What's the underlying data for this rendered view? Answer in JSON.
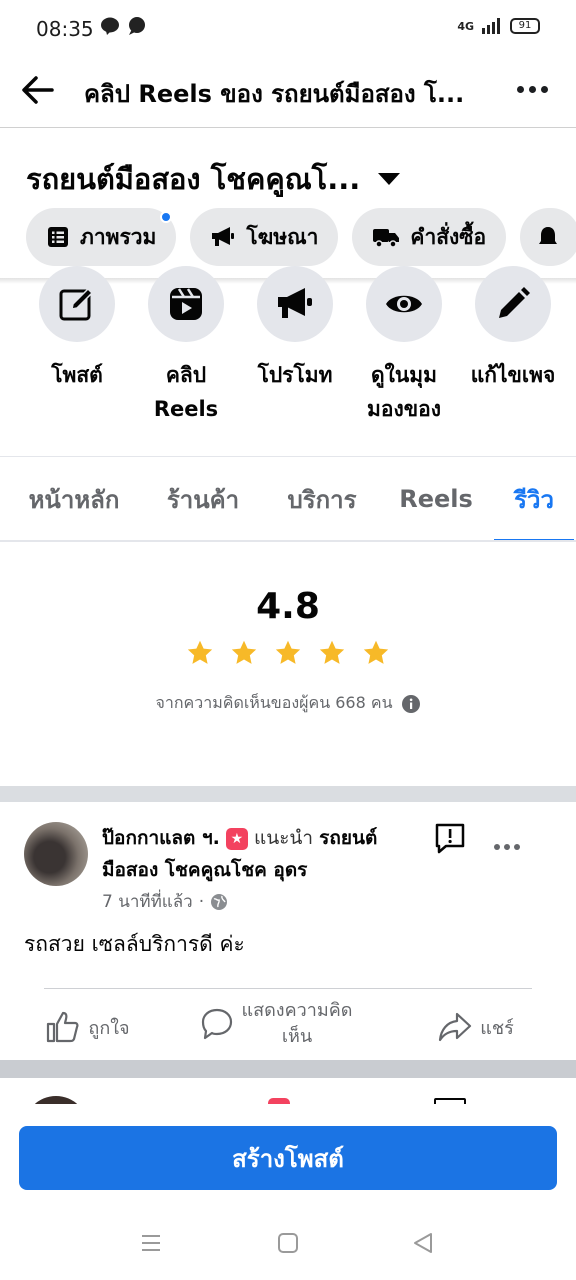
{
  "status_bar": {
    "time": "08:35",
    "network": "4G",
    "battery": "91"
  },
  "header": {
    "title": "คลิป Reels ของ รถยนต์มือสอง โ..."
  },
  "page": {
    "name": "รถยนต์มือสอง โชคคูณโ..."
  },
  "pills": [
    {
      "label": "ภาพรวม",
      "icon": "list-icon"
    },
    {
      "label": "โฆษณา",
      "icon": "megaphone-icon"
    },
    {
      "label": "คำสั่งซื้อ",
      "icon": "truck-icon"
    }
  ],
  "actions": [
    {
      "label": "โพสต์",
      "icon": "edit-square-icon"
    },
    {
      "label": "คลิป Reels",
      "icon": "reels-icon"
    },
    {
      "label": "โปรโมท",
      "icon": "megaphone-icon"
    },
    {
      "label": "ดูในมุมมองของ",
      "icon": "eye-icon"
    },
    {
      "label": "แก้ไขเพจ",
      "icon": "pencil-icon"
    }
  ],
  "tabs": [
    {
      "label": "หน้าหลัก",
      "active": false
    },
    {
      "label": "ร้านค้า",
      "active": false
    },
    {
      "label": "บริการ",
      "active": false
    },
    {
      "label": "Reels",
      "active": false
    },
    {
      "label": "รีวิว",
      "active": true
    }
  ],
  "rating": {
    "value": "4.8",
    "stars": 5,
    "count_text": "จากความคิดเห็นของผู้คน 668 คน"
  },
  "review": {
    "reviewer": "ป๊อกกาแลต ฯ.",
    "recommends": "แนะนำ",
    "page_line1": "รถยนต์",
    "page_line2": "มือสอง โชคคูณโชค อุดร",
    "time": "7 นาทีที่แล้ว",
    "separator": "·",
    "text": "รถสวย เซลล์บริการดี ค่ะ",
    "like": "ถูกใจ",
    "comment_line1": "แสดงความคิด",
    "comment_line2": "เห็น",
    "share": "แชร์"
  },
  "create_post": "สร้างโพสต์",
  "colors": {
    "accent": "#1877f2",
    "star": "#f7b928",
    "button": "#1b74e4"
  }
}
